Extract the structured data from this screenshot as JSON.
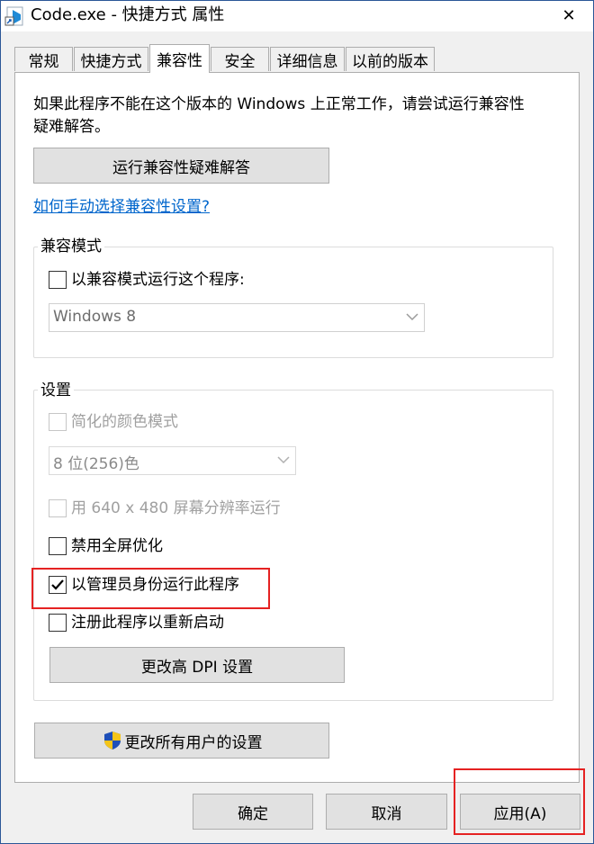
{
  "window": {
    "title": "Code.exe - 快捷方式 属性",
    "close": "✕"
  },
  "tabs": [
    {
      "label": "常规"
    },
    {
      "label": "快捷方式"
    },
    {
      "label": "兼容性"
    },
    {
      "label": "安全"
    },
    {
      "label": "详细信息"
    },
    {
      "label": "以前的版本"
    }
  ],
  "active_tab": "兼容性",
  "intro_text": {
    "line1": "如果此程序不能在这个版本的 Windows 上正常工作，请尝试运行兼容性",
    "line2": "疑难解答。"
  },
  "troubleshoot_button": "运行兼容性疑难解答",
  "manual_link": "如何手动选择兼容性设置?",
  "compat_mode": {
    "legend": "兼容模式",
    "checkbox_label": "以兼容模式运行这个程序:",
    "checked": false,
    "select_value": "Windows 8"
  },
  "settings": {
    "legend": "设置",
    "reduced_color": {
      "label": "简化的颜色模式",
      "checked": false,
      "enabled": false
    },
    "color_select": "8 位(256)色",
    "run_640": {
      "label": "用 640 x 480 屏幕分辨率运行",
      "checked": false,
      "enabled": false
    },
    "disable_fullscreen": {
      "label": "禁用全屏优化",
      "checked": false,
      "enabled": true
    },
    "run_as_admin": {
      "label": "以管理员身份运行此程序",
      "checked": true,
      "enabled": true
    },
    "register_restart": {
      "label": "注册此程序以重新启动",
      "checked": false,
      "enabled": true
    },
    "dpi_button": "更改高 DPI 设置"
  },
  "all_users_button": "更改所有用户的设置",
  "footer": {
    "ok": "确定",
    "cancel": "取消",
    "apply": "应用(A)"
  },
  "colors": {
    "highlight": "#e52222",
    "link": "#0066cc",
    "accent_frame": "#2b5797"
  }
}
